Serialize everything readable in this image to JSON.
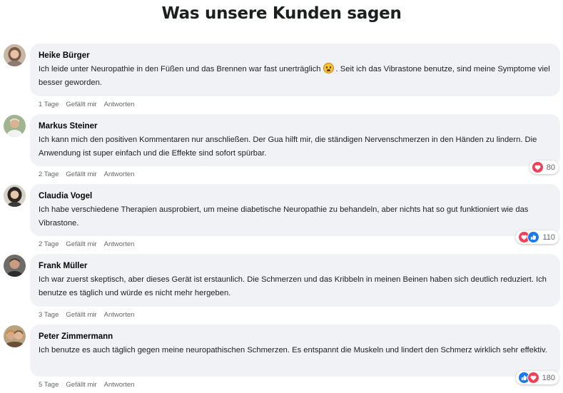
{
  "page": {
    "title": "Was unsere Kunden sagen"
  },
  "colors": {
    "bubble": "#f0f2f5",
    "meta": "#65676b",
    "heart": "#f33e58",
    "like": "#1877f2"
  },
  "action_labels": {
    "like": "Gefällt mir",
    "reply": "Antworten"
  },
  "comments": [
    {
      "name": "Heike Bürger",
      "text_before": "Ich leide unter Neuropathie in den Füßen und das Brennen war fast unerträglich",
      "emoji": "weary-face-icon",
      "text_after": ". Seit ich das Vibrastone benutze, sind meine Symptome viel besser geworden.",
      "time": "1 Tage",
      "reactions": null
    },
    {
      "name": "Markus Steiner",
      "text": "Ich kann mich den positiven Kommentaren nur anschließen. Der Gua hilft mir, die ständigen Nervenschmerzen in den Händen zu lindern. Die Anwendung ist super einfach und die Effekte sind sofort spürbar.",
      "time": "2 Tage",
      "reactions": {
        "icons": [
          "heart-icon"
        ],
        "count": "80"
      }
    },
    {
      "name": "Claudia Vogel",
      "text": "Ich habe verschiedene Therapien ausprobiert, um meine diabetische Neuropathie zu behandeln, aber nichts hat so gut funktioniert wie das Vibrastone.",
      "time": "2 Tage",
      "reactions": {
        "icons": [
          "heart-icon",
          "like-icon"
        ],
        "count": "110"
      }
    },
    {
      "name": "Frank Müller",
      "text": "Ich war zuerst skeptisch, aber dieses Gerät ist erstaunlich. Die Schmerzen und das Kribbeln in meinen Beinen haben sich deutlich reduziert. Ich benutze es täglich und würde es nicht mehr hergeben.",
      "time": "3 Tage",
      "reactions": null
    },
    {
      "name": "Peter Zimmermann",
      "text": "Ich benutze es auch täglich gegen meine neuropathischen Schmerzen. Es entspannt die Muskeln und lindert den Schmerz wirklich sehr effektiv.",
      "time": "5 Tage",
      "reactions": {
        "icons": [
          "like-icon",
          "heart-icon"
        ],
        "count": "180"
      }
    }
  ]
}
